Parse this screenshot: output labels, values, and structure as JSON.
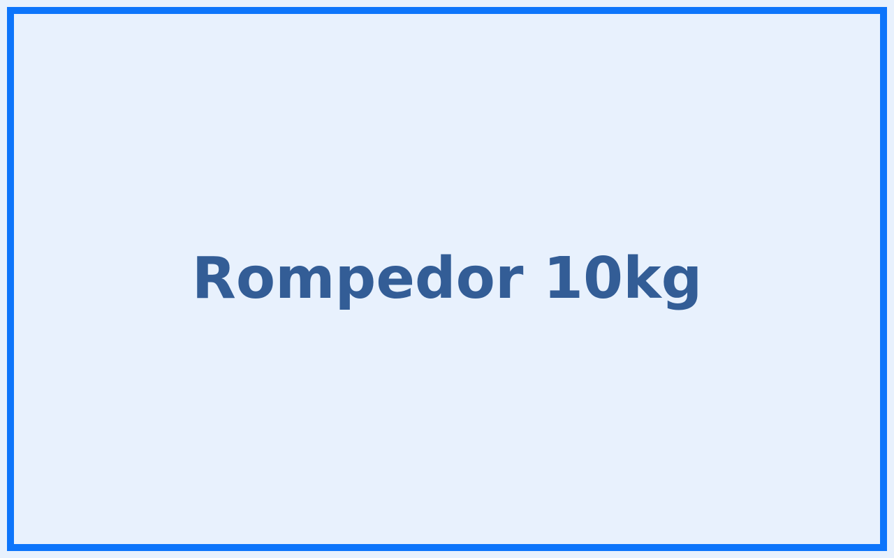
{
  "card": {
    "title": "Rompedor 10kg"
  },
  "colors": {
    "background": "#e8f1fd",
    "border": "#0d75fb",
    "text": "#335d96"
  }
}
